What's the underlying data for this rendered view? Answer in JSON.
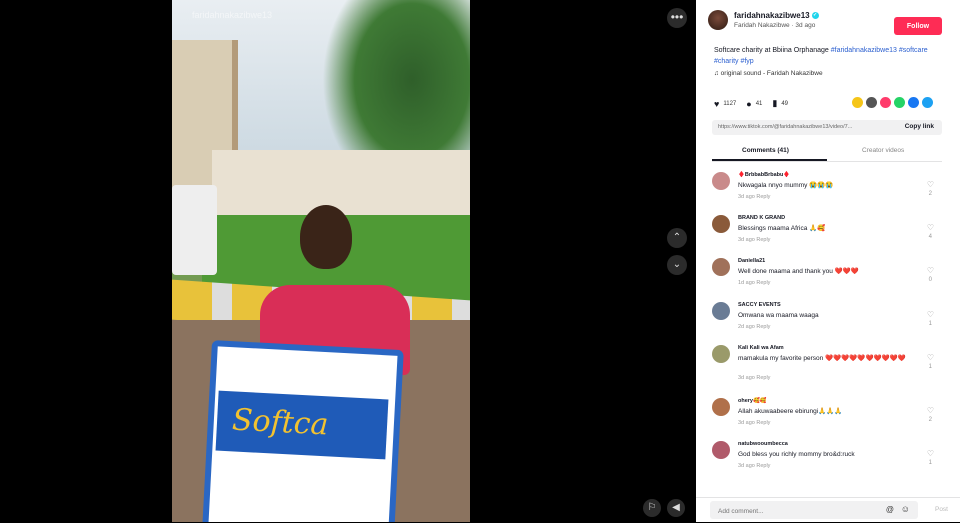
{
  "video": {
    "watermark": "faridahnakazibwe13",
    "bag_logo": "Softca"
  },
  "controls": {
    "more": "•••",
    "prev": "⌃",
    "next": "⌄",
    "report": "⚐",
    "mute": "◀"
  },
  "author": {
    "username": "faridahnakazibwe13",
    "verified": "✓",
    "display_name": "Faridah Nakazibwe",
    "posted": "3d ago",
    "follow_label": "Follow"
  },
  "caption": {
    "text": "Softcare charity at Bbiina Orphanage",
    "tags": [
      "#faridahnakazibwe13",
      "#softcare",
      "#charity",
      "#fyp"
    ]
  },
  "sound": "♫  original sound - Faridah Nakazibwe",
  "stats": {
    "likes": "1127",
    "comments": "41",
    "saves": "49"
  },
  "share_colors": [
    "#f5c518",
    "#555555",
    "#ff3b6b",
    "#25d366",
    "#1877f2",
    "#1da1f2"
  ],
  "link": {
    "url": "https://www.tiktok.com/@faridahnakazibwe13/video/7...",
    "copy_label": "Copy link"
  },
  "tabs": {
    "comments": "Comments (41)",
    "creator": "Creator videos"
  },
  "comments": [
    {
      "name": "♦️BrbbabBrbabu♦️",
      "text": "Nkwagala nnyo mummy 😭😭😭",
      "meta": "3d ago    Reply",
      "likes": "2",
      "color": "#c98a8a"
    },
    {
      "name": "BRAND K GRAND",
      "text": "Blessings maama Africa 🙏🥰",
      "meta": "3d ago    Reply",
      "likes": "4",
      "color": "#8a5a3a"
    },
    {
      "name": "Daniella21",
      "text": "Well done maama and thank you ❤️❤️❤️",
      "meta": "1d ago    Reply",
      "likes": "0",
      "color": "#a0715a"
    },
    {
      "name": "SACCY EVENTS",
      "text": "Omwana wa maama waaga",
      "meta": "2d ago    Reply",
      "likes": "1",
      "color": "#6a7c95"
    },
    {
      "name": "Kali Kali wa Afam",
      "text": "mamakula my favorite person ❤️❤️❤️❤️❤️❤️❤️❤️❤️❤️",
      "meta": "3d ago    Reply",
      "likes": "1",
      "color": "#9a9a6a"
    },
    {
      "name": "ohery🥰🥰",
      "text": "Allah akuwaabeere ebirungi🙏🙏🙏",
      "meta": "3d ago    Reply",
      "likes": "2",
      "color": "#b0704a"
    },
    {
      "name": "natubwooumbecca",
      "text": "God bless you richly mommy bro&d:ruck",
      "meta": "3d ago    Reply",
      "likes": "1",
      "color": "#b05a6a"
    }
  ],
  "composer": {
    "placeholder": "Add comment...",
    "at": "@",
    "emoji": "☺",
    "post_label": "Post"
  }
}
